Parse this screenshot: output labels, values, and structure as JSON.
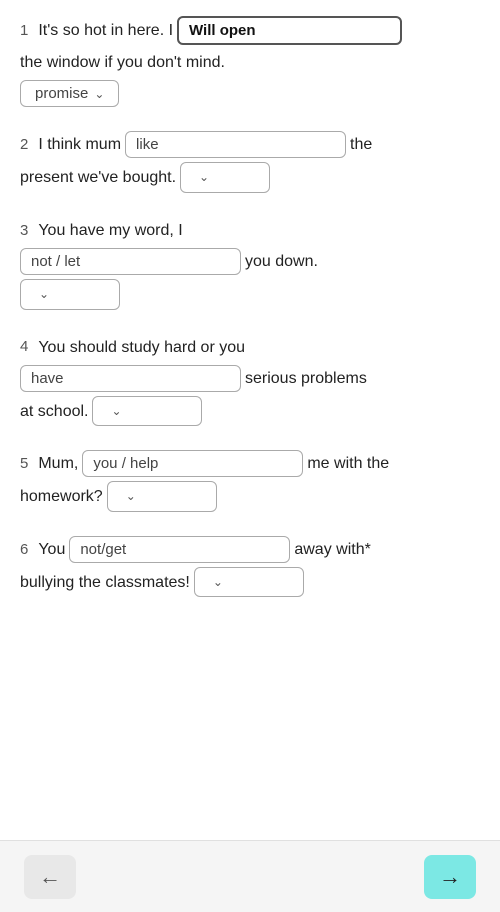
{
  "questions": [
    {
      "number": "1",
      "parts": [
        {
          "type": "text",
          "value": "It's so hot in here. I"
        },
        {
          "type": "input",
          "value": "Will open",
          "style": "highlight"
        },
        {
          "type": "text",
          "value": "the window if you don't mind."
        }
      ],
      "dropdown": {
        "label": "promise",
        "hasChevron": true
      }
    },
    {
      "number": "2",
      "parts": [
        {
          "type": "text",
          "value": "I think mum"
        },
        {
          "type": "input",
          "value": "like",
          "style": "normal"
        },
        {
          "type": "text",
          "value": "the present we've bought."
        }
      ],
      "dropdown": {
        "label": "",
        "hasChevron": true
      }
    },
    {
      "number": "3",
      "parts": [
        {
          "type": "text",
          "value": "You have my word, I"
        }
      ],
      "line2": [
        {
          "type": "input",
          "value": "not / let",
          "style": "normal"
        },
        {
          "type": "text",
          "value": "you down."
        }
      ],
      "dropdown": {
        "label": "",
        "hasChevron": true
      }
    },
    {
      "number": "4",
      "parts": [
        {
          "type": "text",
          "value": "You should study hard or you"
        }
      ],
      "line2": [
        {
          "type": "input",
          "value": "have",
          "style": "normal"
        },
        {
          "type": "text",
          "value": "serious problems at school."
        }
      ],
      "dropdown": {
        "label": "",
        "hasChevron": true
      }
    },
    {
      "number": "5",
      "parts": [
        {
          "type": "text",
          "value": "Mum,"
        },
        {
          "type": "input",
          "value": "you / help",
          "style": "normal"
        },
        {
          "type": "text",
          "value": "me with the homework?"
        }
      ],
      "dropdown": {
        "label": "",
        "hasChevron": true
      }
    },
    {
      "number": "6",
      "parts": [
        {
          "type": "text",
          "value": "You"
        },
        {
          "type": "input",
          "value": "not/get",
          "style": "normal"
        },
        {
          "type": "text",
          "value": "away with* bullying the classmates!"
        }
      ],
      "dropdown": {
        "label": "",
        "hasChevron": true
      }
    }
  ],
  "nav": {
    "back_label": "←",
    "forward_label": "→"
  }
}
